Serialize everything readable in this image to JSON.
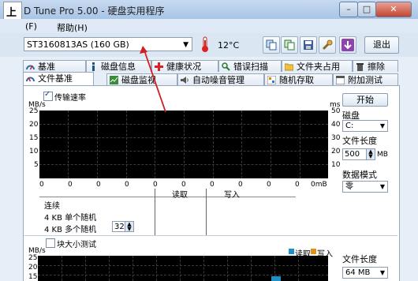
{
  "window": {
    "logo": "上",
    "title": "D Tune Pro 5.00 - 硬盘实用程序"
  },
  "menu": [
    {
      "label": "(F)"
    },
    {
      "label": "帮助(H)"
    }
  ],
  "toolbar": {
    "drive": "ST3160813AS (160 GB)",
    "temperature": "12°C",
    "exit_label": "退出"
  },
  "tabs_top": [
    {
      "label": "基准",
      "icon": "gauge-icon"
    },
    {
      "label": "磁盘信息",
      "icon": "info-icon"
    },
    {
      "label": "健康状况",
      "icon": "health-cross-icon"
    },
    {
      "label": "错误扫描",
      "icon": "magnifier-icon"
    },
    {
      "label": "文件夹占用",
      "icon": "folder-icon"
    },
    {
      "label": "擦除",
      "icon": "trash-icon"
    }
  ],
  "tabs_bottom": [
    {
      "label": "文件基准",
      "icon": "file-gauge-icon"
    },
    {
      "label": "磁盘监视",
      "icon": "monitor-icon"
    },
    {
      "label": "自动噪音管理",
      "icon": "speaker-icon"
    },
    {
      "label": "随机存取",
      "icon": "random-icon"
    },
    {
      "label": "附加测试",
      "icon": "extra-icon"
    }
  ],
  "transfer_chart": {
    "checkbox_label": "传输速率",
    "left_unit": "MB/s",
    "right_unit": "ms",
    "y_left": [
      "25",
      "20",
      "15",
      "10",
      "5"
    ],
    "y_right": [
      "50",
      "40",
      "30",
      "20",
      "10"
    ],
    "x_ticks": [
      "0",
      "0",
      "0",
      "0",
      "0",
      "0",
      "0",
      "0",
      "0",
      "0",
      "0mB"
    ]
  },
  "results_table": {
    "col_read": "读取",
    "col_write": "写入",
    "row_seq": "连续",
    "row_4k_single": "4 KB 单个随机",
    "row_4k_multi": "4 KB 多个随机",
    "queue_depth": "32"
  },
  "side_panel": {
    "start_label": "开始",
    "disk_label": "磁盘",
    "disk_value": "C:",
    "file_length_label": "文件长度",
    "file_length_value": "500",
    "file_length_unit": "MB",
    "data_mode_label": "数据模式",
    "data_mode_value": "零"
  },
  "block_chart": {
    "checkbox_label": "块大小测试",
    "unit": "MB/s",
    "legend_read": "读取",
    "legend_write": "写入",
    "y_left": [
      "25",
      "20",
      "15"
    ],
    "file_length_label": "文件长度",
    "file_length_value": "64 MB"
  }
}
